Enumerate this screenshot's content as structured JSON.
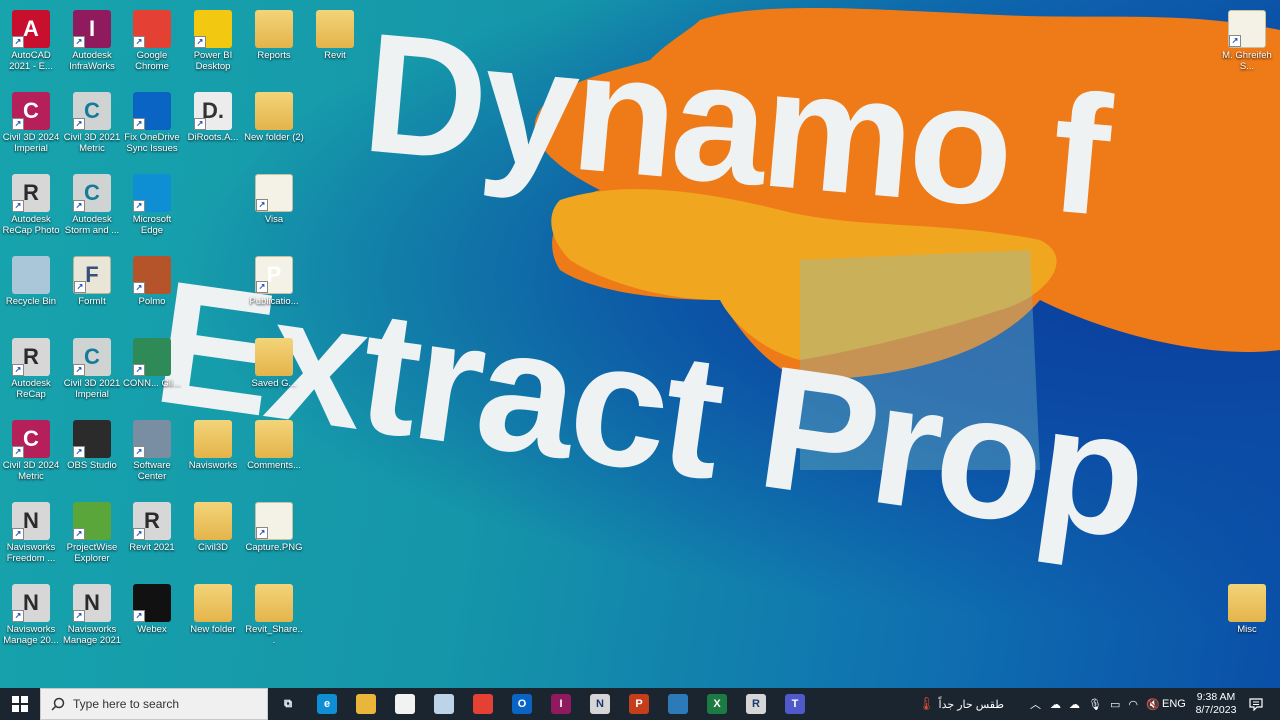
{
  "colors": {
    "orange_splash": "#ee7a18",
    "yellow_splash": "#f1a620",
    "title_text": "#eef2f2",
    "taskbar": "#1b2530"
  },
  "overlay": {
    "line1": "Dynamo f",
    "line2": "Extract Prop"
  },
  "desktop_icons": [
    {
      "label": "AutoCAD 2021 - E...",
      "icon": "autocad-icon",
      "glyph": "A"
    },
    {
      "label": "Civil 3D 2024 Imperial",
      "icon": "civil3d-icon",
      "glyph": "C"
    },
    {
      "label": "Autodesk ReCap Photo",
      "icon": "recap-photo-icon",
      "glyph": "R"
    },
    {
      "label": "Recycle Bin",
      "icon": "recycle-bin-icon",
      "glyph": ""
    },
    {
      "label": "Autodesk ReCap",
      "icon": "recap-icon",
      "glyph": "R"
    },
    {
      "label": "Civil 3D 2024 Metric",
      "icon": "civil3d-icon",
      "glyph": "C"
    },
    {
      "label": "Navisworks Freedom ...",
      "icon": "navisworks-freedom-icon",
      "glyph": "N"
    },
    {
      "label": "Navisworks Manage 20...",
      "icon": "navisworks-manage-icon",
      "glyph": "N"
    },
    {
      "label": "Autodesk InfraWorks",
      "icon": "infraworks-icon",
      "glyph": "I"
    },
    {
      "label": "Civil 3D 2021 Metric",
      "icon": "civil3d-2021-icon",
      "glyph": "C"
    },
    {
      "label": "Autodesk Storm and ...",
      "icon": "storm-sanitary-icon",
      "glyph": "C"
    },
    {
      "label": "FormIt",
      "icon": "formit-icon",
      "glyph": "F"
    },
    {
      "label": "Civil 3D 2021 Imperial",
      "icon": "civil3d-2021-icon",
      "glyph": "C"
    },
    {
      "label": "OBS Studio",
      "icon": "obs-icon",
      "glyph": ""
    },
    {
      "label": "ProjectWise Explorer",
      "icon": "projectwise-icon",
      "glyph": ""
    },
    {
      "label": "Navisworks Manage 2021",
      "icon": "navisworks-manage-icon",
      "glyph": "N"
    },
    {
      "label": "Google Chrome",
      "icon": "chrome-icon",
      "glyph": ""
    },
    {
      "label": "Fix OneDrive Sync Issues",
      "icon": "onedrive-icon",
      "glyph": ""
    },
    {
      "label": "Microsoft Edge",
      "icon": "edge-icon",
      "glyph": ""
    },
    {
      "label": "Polmo",
      "icon": "app-icon",
      "glyph": ""
    },
    {
      "label": "CONN... Gli...",
      "icon": "connect-icon",
      "glyph": ""
    },
    {
      "label": "Software Center",
      "icon": "software-center-icon",
      "glyph": ""
    },
    {
      "label": "Revit 2021",
      "icon": "revit-icon",
      "glyph": "R"
    },
    {
      "label": "Webex",
      "icon": "webex-icon",
      "glyph": ""
    },
    {
      "label": "Power BI Desktop",
      "icon": "powerbi-icon",
      "glyph": ""
    },
    {
      "label": "DiRoots.A...",
      "icon": "diroots-icon",
      "glyph": "D."
    },
    {
      "label": "Navisworks",
      "icon": "folder-icon",
      "glyph": ""
    },
    {
      "label": "Civil3D",
      "icon": "folder-icon",
      "glyph": ""
    },
    {
      "label": "New folder",
      "icon": "folder-icon",
      "glyph": ""
    },
    {
      "label": "Reports",
      "icon": "folder-icon",
      "glyph": ""
    },
    {
      "label": "New folder (2)",
      "icon": "folder-icon",
      "glyph": ""
    },
    {
      "label": "Visa",
      "icon": "pdf-file-icon",
      "glyph": ""
    },
    {
      "label": "Publicatio...",
      "icon": "publisher-icon",
      "glyph": "P"
    },
    {
      "label": "Saved G...",
      "icon": "folder-icon",
      "glyph": ""
    },
    {
      "label": "Comments...",
      "icon": "folder-icon",
      "glyph": ""
    },
    {
      "label": "Capture.PNG",
      "icon": "image-file-icon",
      "glyph": ""
    },
    {
      "label": "Revit_Share...",
      "icon": "folder-icon",
      "glyph": ""
    },
    {
      "label": "Revit",
      "icon": "folder-icon",
      "glyph": ""
    },
    {
      "label": "M. Ghreifeh S...",
      "icon": "file-icon",
      "glyph": ""
    },
    {
      "label": "Misc",
      "icon": "folder-icon",
      "glyph": ""
    }
  ],
  "taskbar": {
    "search_placeholder": "Type here to search",
    "weather": "طقس حار جداً",
    "language": "ENG",
    "time": "9:38 AM",
    "date": "8/7/2023",
    "pinned": [
      {
        "name": "task-view-icon",
        "color": "#1b2530",
        "glyph": "⧉"
      },
      {
        "name": "edge-icon",
        "color": "#0f8fd3",
        "glyph": "e"
      },
      {
        "name": "file-explorer-icon",
        "color": "#e9b53b",
        "glyph": ""
      },
      {
        "name": "store-icon",
        "color": "#f2f2f2",
        "glyph": ""
      },
      {
        "name": "paint-icon",
        "color": "#bcd3e8",
        "glyph": ""
      },
      {
        "name": "chrome-icon",
        "color": "#e44134",
        "glyph": ""
      },
      {
        "name": "outlook-icon",
        "color": "#0a64c4",
        "glyph": "O"
      },
      {
        "name": "infraworks-icon",
        "color": "#8f1b5e",
        "glyph": "I"
      },
      {
        "name": "navisworks-icon",
        "color": "#d6d6d6",
        "glyph": "N"
      },
      {
        "name": "powerpoint-icon",
        "color": "#c43e1c",
        "glyph": "P"
      },
      {
        "name": "photos-icon",
        "color": "#2a7bb8",
        "glyph": ""
      },
      {
        "name": "excel-icon",
        "color": "#1d7a43",
        "glyph": "X"
      },
      {
        "name": "revit-icon",
        "color": "#d6d6d6",
        "glyph": "R"
      },
      {
        "name": "teams-icon",
        "color": "#5059c9",
        "glyph": "T"
      }
    ]
  }
}
